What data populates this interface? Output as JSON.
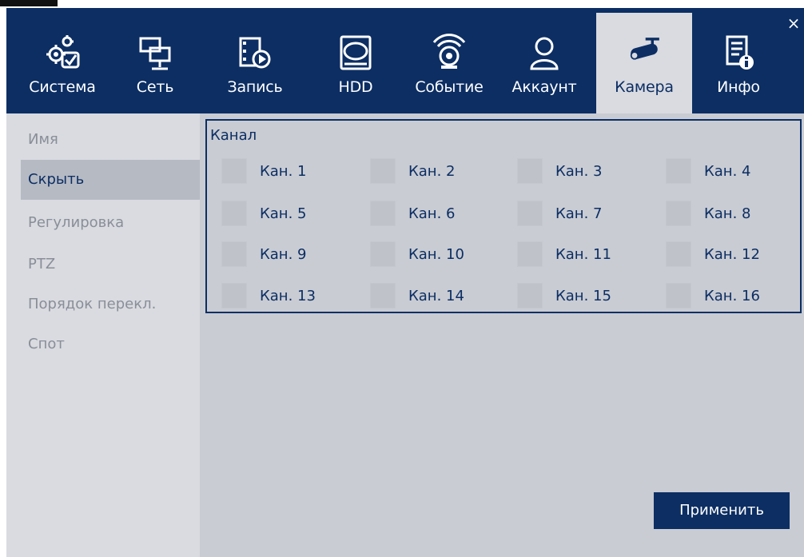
{
  "tabs": [
    {
      "label": "Система",
      "icon": "system-gears-icon"
    },
    {
      "label": "Сеть",
      "icon": "network-icon"
    },
    {
      "label": "Запись",
      "icon": "record-icon"
    },
    {
      "label": "HDD",
      "icon": "hdd-icon"
    },
    {
      "label": "Событие",
      "icon": "event-alarm-icon"
    },
    {
      "label": "Аккаунт",
      "icon": "account-user-icon"
    },
    {
      "label": "Камера",
      "icon": "camera-icon",
      "active": true
    },
    {
      "label": "Инфо",
      "icon": "info-document-icon"
    }
  ],
  "close_label": "×",
  "sidebar": {
    "items": [
      {
        "label": "Имя"
      },
      {
        "label": "Скрыть",
        "active": true
      },
      {
        "label": "Регулировка"
      },
      {
        "label": "PTZ"
      },
      {
        "label": "Порядок перекл."
      },
      {
        "label": "Спот"
      }
    ]
  },
  "channels": {
    "title": "Канал",
    "items": [
      {
        "label": "Кан. 1",
        "checked": false
      },
      {
        "label": "Кан. 2",
        "checked": false
      },
      {
        "label": "Кан. 3",
        "checked": false
      },
      {
        "label": "Кан. 4",
        "checked": false
      },
      {
        "label": "Кан. 5",
        "checked": false
      },
      {
        "label": "Кан. 6",
        "checked": false
      },
      {
        "label": "Кан. 7",
        "checked": false
      },
      {
        "label": "Кан. 8",
        "checked": false
      },
      {
        "label": "Кан. 9",
        "checked": false
      },
      {
        "label": "Кан. 10",
        "checked": false
      },
      {
        "label": "Кан. 11",
        "checked": false
      },
      {
        "label": "Кан. 12",
        "checked": false
      },
      {
        "label": "Кан. 13",
        "checked": false
      },
      {
        "label": "Кан. 14",
        "checked": false
      },
      {
        "label": "Кан. 15",
        "checked": false
      },
      {
        "label": "Кан. 16",
        "checked": false
      }
    ]
  },
  "apply_label": "Применить",
  "colors": {
    "navy": "#0c2e63",
    "panel_gray": "#d9dbe1",
    "text_gray": "#8a8e97"
  }
}
